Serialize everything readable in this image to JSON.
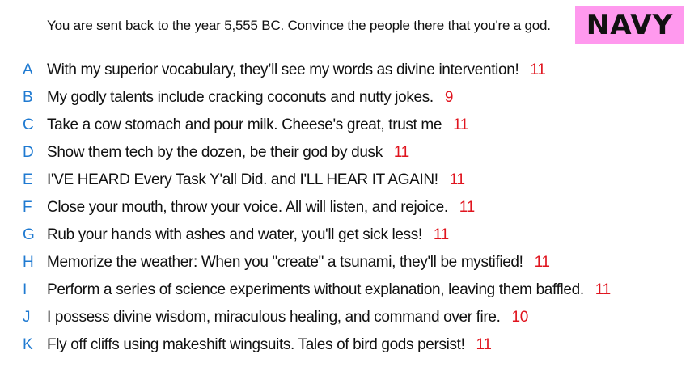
{
  "prompt": "You are sent back to the year 5,555 BC. Convince the people there that you're a god.",
  "team": {
    "name": "NAVY",
    "color": "#ff99ee"
  },
  "colors": {
    "letter": "#1f7ad1",
    "score": "#e0141e",
    "text": "#111111"
  },
  "answers": [
    {
      "letter": "A",
      "text": "With my superior vocabulary, they’ll see my words as divine intervention!",
      "score": "11"
    },
    {
      "letter": "B",
      "text": "My godly talents include cracking coconuts and nutty jokes.",
      "score": "9"
    },
    {
      "letter": "C",
      "text": "Take a cow stomach and pour milk. Cheese's great, trust me",
      "score": "11"
    },
    {
      "letter": "D",
      "text": "Show them tech by the dozen, be their god by dusk",
      "score": "11"
    },
    {
      "letter": "E",
      "text": "I'VE HEARD Every Task Y'all Did. and I'LL HEAR IT AGAIN!",
      "score": "11"
    },
    {
      "letter": "F",
      "text": "Close your mouth, throw your voice. All will listen, and rejoice.",
      "score": "11"
    },
    {
      "letter": "G",
      "text": "Rub your hands with ashes and water, you'll get sick less!",
      "score": "11"
    },
    {
      "letter": "H",
      "text": "Memorize the weather: When you \"create\" a tsunami, they'll be mystified!",
      "score": "11"
    },
    {
      "letter": "I",
      "text": "Perform a series of science experiments without explanation, leaving them baffled.",
      "score": "11"
    },
    {
      "letter": "J",
      "text": "I possess divine wisdom, miraculous healing, and command over fire.",
      "score": "10"
    },
    {
      "letter": "K",
      "text": "Fly off cliffs using makeshift wingsuits. Tales of bird gods persist!",
      "score": "11"
    }
  ]
}
